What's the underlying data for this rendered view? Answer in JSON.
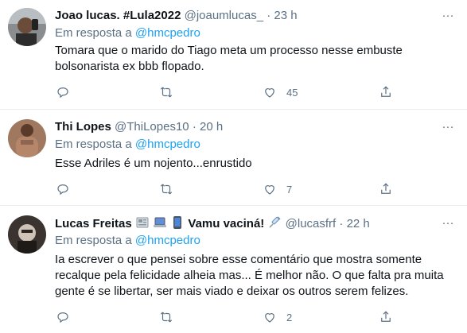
{
  "tweets": [
    {
      "name": "Joao lucas. #Lula2022",
      "handle": "@joaumlucas_",
      "dot": "·",
      "time": "23 h",
      "reply_prefix": "Em resposta a",
      "reply_to": "@hmcpedro",
      "text_lines": [
        "Tomara que o marido do Tiago meta um processo nesse embuste",
        "bolsonarista ex bbb flopado."
      ],
      "likes": "45",
      "retweets": "",
      "replies": ""
    },
    {
      "name": "Thi Lopes",
      "handle": "@ThiLopes10",
      "dot": "·",
      "time": "20 h",
      "reply_prefix": "Em resposta a",
      "reply_to": "@hmcpedro",
      "text_lines": [
        "Esse Adriles é um nojento...enrustido"
      ],
      "likes": "7",
      "retweets": "",
      "replies": ""
    },
    {
      "name": "Lucas Freitas",
      "name_suffix": "Vamu vaciná!",
      "handle": "@lucasfrf",
      "dot": "·",
      "time": "22 h",
      "reply_prefix": "Em resposta a",
      "reply_to": "@hmcpedro",
      "text_lines": [
        "Ia escrever o que pensei sobre esse comentário que mostra somente",
        "recalque pela felicidade alheia mas... É melhor não. O que falta pra muita",
        "gente é se libertar, ser mais viado e deixar os outros serem felizes."
      ],
      "likes": "2",
      "retweets": "",
      "replies": ""
    }
  ],
  "more_glyph": "···",
  "colors": {
    "accent": "#1da1f2",
    "secondary": "#5b7083",
    "text": "#0f1419",
    "divider": "#ebeef0"
  },
  "icons": [
    "reply-icon",
    "retweet-icon",
    "like-icon",
    "share-icon",
    "more-icon",
    "newspaper-emoji",
    "laptop-emoji",
    "phone-emoji",
    "syringe-emoji"
  ]
}
